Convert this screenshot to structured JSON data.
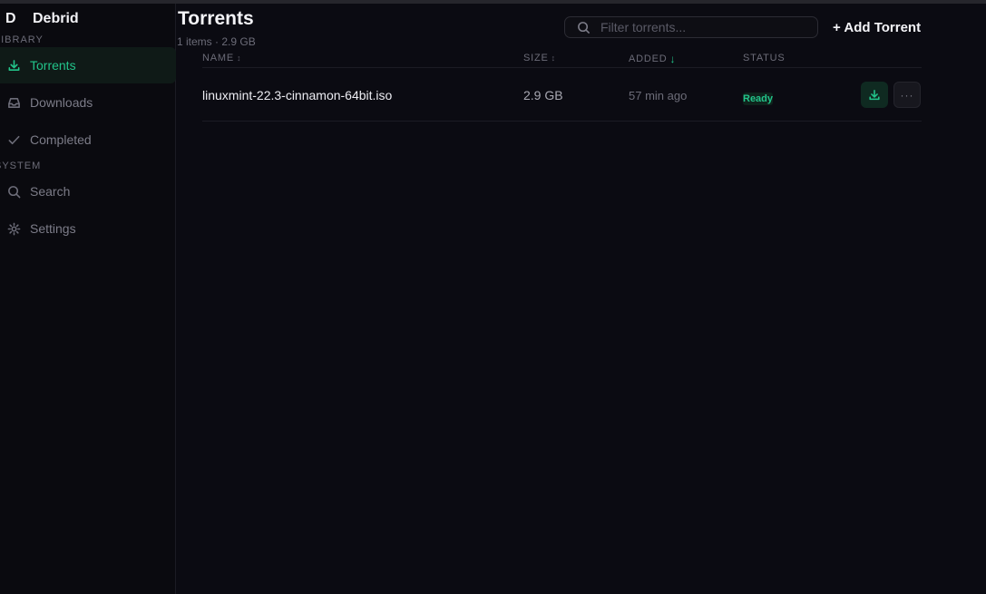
{
  "app": {
    "logo": "D",
    "name": "Debrid"
  },
  "sidebar": {
    "library_label": "Library",
    "system_label": "System",
    "items": [
      {
        "label": "Torrents",
        "icon": "download-icon",
        "active": true
      },
      {
        "label": "Downloads",
        "icon": "inbox-icon",
        "active": false
      },
      {
        "label": "Completed",
        "icon": "check-icon",
        "active": false
      },
      {
        "label": "Search",
        "icon": "search-icon",
        "active": false
      },
      {
        "label": "Settings",
        "icon": "gear-icon",
        "active": false
      }
    ]
  },
  "header": {
    "title": "Torrents",
    "subtitle": "1 items · 2.9 GB",
    "filter_placeholder": "Filter torrents...",
    "add_label": "+ Add Torrent"
  },
  "table": {
    "columns": [
      {
        "label": "Name",
        "sort": "↕"
      },
      {
        "label": "Size",
        "sort": "↕"
      },
      {
        "label": "Added",
        "sort": "↓"
      },
      {
        "label": "Status",
        "sort": ""
      }
    ],
    "rows": [
      {
        "name": "linuxmint-22.3-cinnamon-64bit.iso",
        "size": "2.9 GB",
        "added": "57 min ago",
        "status": "Ready",
        "more_label": "···"
      }
    ]
  },
  "colors": {
    "accent": "#22c48a",
    "background": "#0b0b12",
    "sidebar": "#0a0a0f"
  }
}
